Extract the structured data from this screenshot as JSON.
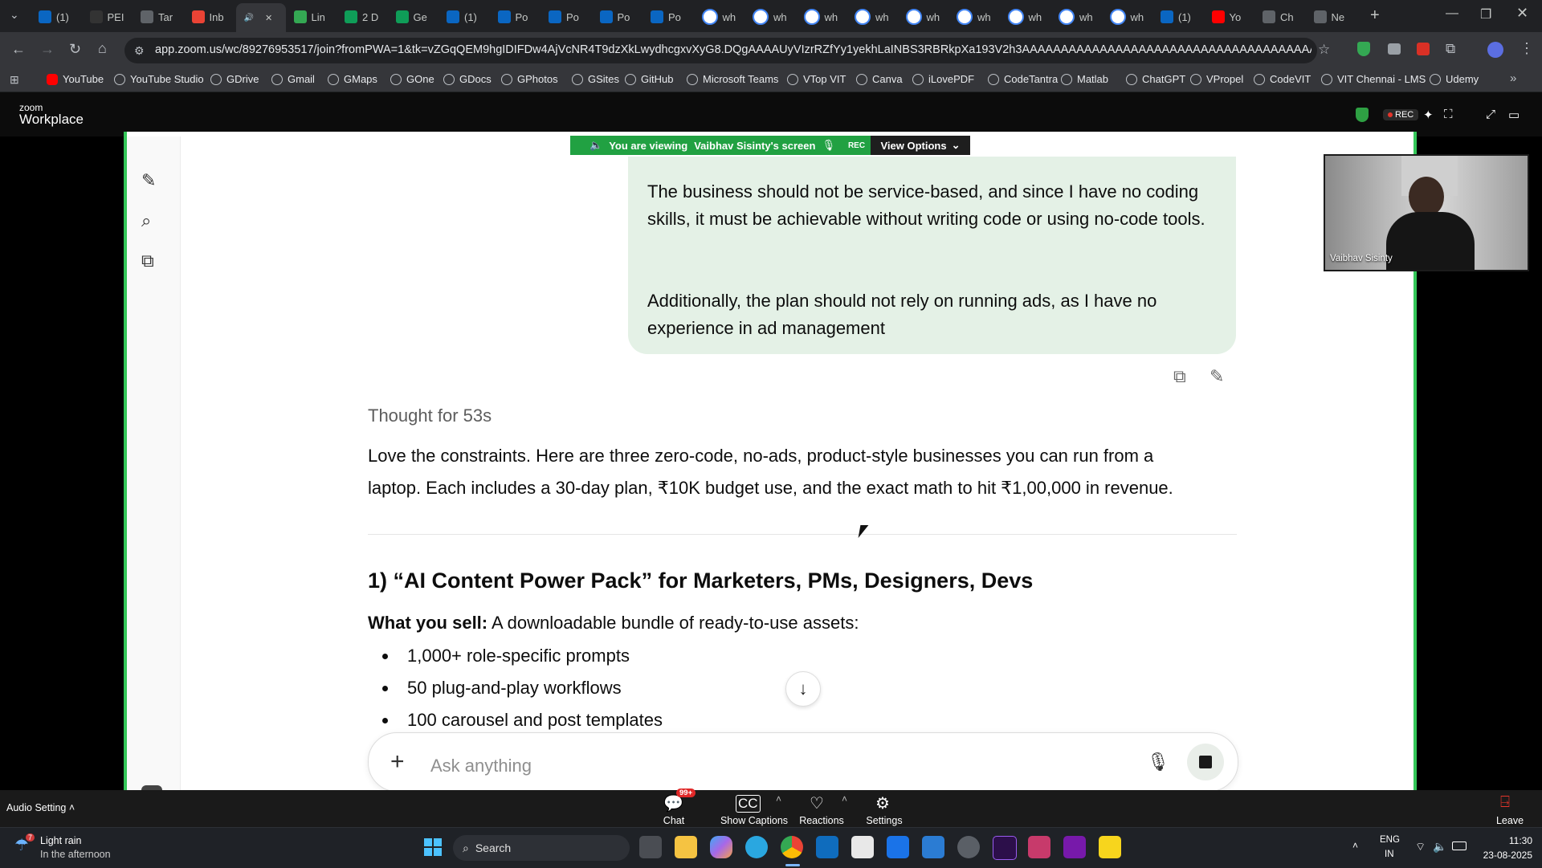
{
  "browser": {
    "tabs": [
      {
        "label": "(1)",
        "icon": "linkedin",
        "color": "#0a66c2"
      },
      {
        "label": "PEI",
        "icon": "github",
        "color": "#333333"
      },
      {
        "label": "Tar",
        "icon": "globe",
        "color": "#5f6368"
      },
      {
        "label": "Inb",
        "icon": "gmail",
        "color": "#ea4335"
      },
      {
        "label": "",
        "icon": "zoom-audio",
        "color": "#5f6368",
        "active": true
      },
      {
        "label": "Lin",
        "icon": "grid",
        "color": "#34a853"
      },
      {
        "label": "2 D",
        "icon": "sheets",
        "color": "#0f9d58"
      },
      {
        "label": "Ge",
        "icon": "sheets",
        "color": "#0f9d58"
      },
      {
        "label": "(1)",
        "icon": "linkedin",
        "color": "#0a66c2"
      },
      {
        "label": "Po",
        "icon": "linkedin",
        "color": "#0a66c2"
      },
      {
        "label": "Po",
        "icon": "linkedin",
        "color": "#0a66c2"
      },
      {
        "label": "Po",
        "icon": "linkedin",
        "color": "#0a66c2"
      },
      {
        "label": "Po",
        "icon": "linkedin",
        "color": "#0a66c2"
      },
      {
        "label": "wh",
        "icon": "google",
        "color": "#ffffff"
      },
      {
        "label": "wh",
        "icon": "google",
        "color": "#ffffff"
      },
      {
        "label": "wh",
        "icon": "google",
        "color": "#ffffff"
      },
      {
        "label": "wh",
        "icon": "google",
        "color": "#ffffff"
      },
      {
        "label": "wh",
        "icon": "google",
        "color": "#ffffff"
      },
      {
        "label": "wh",
        "icon": "google",
        "color": "#ffffff"
      },
      {
        "label": "wh",
        "icon": "google",
        "color": "#ffffff"
      },
      {
        "label": "wh",
        "icon": "google",
        "color": "#ffffff"
      },
      {
        "label": "wh",
        "icon": "google",
        "color": "#ffffff"
      },
      {
        "label": "(1)",
        "icon": "linkedin",
        "color": "#0a66c2"
      },
      {
        "label": "Yo",
        "icon": "youtube",
        "color": "#ff0000"
      },
      {
        "label": "Ch",
        "icon": "chatgpt",
        "color": "#5f6368"
      },
      {
        "label": "Ne",
        "icon": "chatgpt",
        "color": "#5f6368"
      }
    ],
    "url": "app.zoom.us/wc/89276953517/join?fromPWA=1&tk=vZGqQEM9hgIDIFDw4AjVcNR4T9dzXkLwydhcgxvXyG8.DQgAAAAUyVIzrRZfYy1yekhLaINBS3RBRkpXa193V2h3AAAAAAAAAAAAAAAAAAAAAAAAAAAAAAAAAAAAAAA&_x_zm_r...",
    "bookmarks": [
      "YouTube",
      "YouTube Studio",
      "GDrive",
      "Gmail",
      "GMaps",
      "GOne",
      "GDocs",
      "GPhotos",
      "GSites",
      "GitHub",
      "Microsoft Teams",
      "VTop VIT",
      "Canva",
      "iLovePDF",
      "CodeTantra",
      "Matlab",
      "ChatGPT",
      "VPropel",
      "CodeVIT",
      "VIT Chennai - LMS",
      "Udemy"
    ]
  },
  "zoom": {
    "logo_small": "zoom",
    "logo_big": "Workplace",
    "banner_text": "You are viewing",
    "banner_name": "Vaibhav Sisinty's screen",
    "banner_rec": "REC",
    "view_options": "View Options",
    "rec_badge": "REC",
    "participant_name": "Vaibhav Sisinty",
    "audio_setting": "Audio Setting",
    "chat_label": "Chat",
    "chat_badge": "99+",
    "captions_label": "Show Captions",
    "reactions_label": "Reactions",
    "settings_label": "Settings",
    "leave_label": "Leave"
  },
  "chat": {
    "user_message_p1": "The business should not be service-based, and since I have no coding skills, it must be achievable without writing code or using no-code tools.",
    "user_message_p2": "Additionally, the plan should not rely on running ads, as I have no experience in ad management",
    "thought": "Thought for 53s",
    "intro_line1": "Love the constraints. Here are three zero-code, no-ads, product-style businesses you can run from a",
    "intro_line2": "laptop. Each includes a 30-day plan, ₹10K budget use, and the exact math to hit ₹1,00,000 in revenue.",
    "heading": "1) “AI Content Power Pack” for Marketers, PMs, Designers, Devs",
    "what_sell_label": "What you sell:",
    "what_sell_text": " A downloadable bundle of ready-to-use assets:",
    "bullets": [
      "1,000+ role-specific prompts",
      "50 plug-and-play workflows",
      "100 carousel and post templates"
    ],
    "composer_placeholder": "Ask anything"
  },
  "taskbar": {
    "weather_temp": "7",
    "weather_line1": "Light rain",
    "weather_line2": "In the afternoon",
    "search": "Search",
    "lang1": "ENG",
    "lang2": "IN",
    "time": "11:30",
    "date": "23-08-2025"
  },
  "colors": {
    "share_border": "#34c759",
    "user_bubble": "#e4f1e6",
    "banner_green": "#21a142"
  }
}
